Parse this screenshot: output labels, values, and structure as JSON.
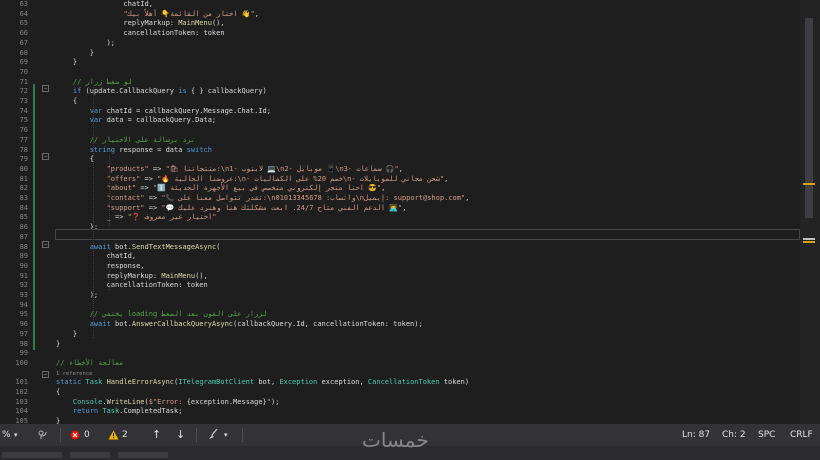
{
  "editor": {
    "lines": [
      {
        "n": "63",
        "code": [
          {
            "c": "p",
            "t": "                chatId,"
          }
        ]
      },
      {
        "n": "64",
        "code": [
          {
            "c": "p",
            "t": "                "
          },
          {
            "c": "s",
            "t": "\"اختار من القائمة👇 أهلاً بيك 👋\""
          },
          {
            "c": "p",
            "t": ","
          }
        ]
      },
      {
        "n": "65",
        "code": [
          {
            "c": "p",
            "t": "                replyMarkup: "
          },
          {
            "c": "m",
            "t": "MainMenu"
          },
          {
            "c": "p",
            "t": "(),"
          }
        ]
      },
      {
        "n": "66",
        "code": [
          {
            "c": "p",
            "t": "                cancellationToken: token"
          }
        ]
      },
      {
        "n": "67",
        "code": [
          {
            "c": "p",
            "t": "            );"
          }
        ]
      },
      {
        "n": "68",
        "code": [
          {
            "c": "p",
            "t": "        }"
          }
        ]
      },
      {
        "n": "69",
        "code": [
          {
            "c": "p",
            "t": "    }"
          }
        ]
      },
      {
        "n": "70",
        "code": []
      },
      {
        "n": "71",
        "code": [
          {
            "c": "c",
            "t": "    // لو ضغط زرار"
          }
        ]
      },
      {
        "n": "72",
        "code": [
          {
            "c": "k",
            "t": "    if"
          },
          {
            "c": "p",
            "t": " (update.CallbackQuery "
          },
          {
            "c": "k",
            "t": "is"
          },
          {
            "c": "p",
            "t": " { } callbackQuery)"
          }
        ]
      },
      {
        "n": "73",
        "code": [
          {
            "c": "p",
            "t": "    {"
          }
        ]
      },
      {
        "n": "74",
        "code": [
          {
            "c": "k",
            "t": "        var"
          },
          {
            "c": "p",
            "t": " chatId = callbackQuery.Message.Chat.Id;"
          }
        ]
      },
      {
        "n": "75",
        "code": [
          {
            "c": "k",
            "t": "        var"
          },
          {
            "c": "p",
            "t": " data = callbackQuery.Data;"
          }
        ]
      },
      {
        "n": "76",
        "code": []
      },
      {
        "n": "77",
        "code": [
          {
            "c": "c",
            "t": "        // نرد برسالة على الاختيار"
          }
        ]
      },
      {
        "n": "78",
        "code": [
          {
            "c": "k",
            "t": "        string"
          },
          {
            "c": "p",
            "t": " response = data "
          },
          {
            "c": "k",
            "t": "switch"
          }
        ]
      },
      {
        "n": "79",
        "code": [
          {
            "c": "p",
            "t": "        {"
          }
        ]
      },
      {
        "n": "80",
        "code": [
          {
            "c": "s",
            "t": "            \"products\""
          },
          {
            "c": "p",
            "t": " => "
          },
          {
            "c": "s",
            "t": "\"🛍 منتجاتنا:\\n1- لابتوب 💻\\n2- موبايل 📱\\n3- سماعات 🎧\""
          },
          {
            "c": "p",
            "t": ","
          }
        ]
      },
      {
        "n": "81",
        "code": [
          {
            "c": "s",
            "t": "            \"offers\""
          },
          {
            "c": "p",
            "t": " => "
          },
          {
            "c": "s",
            "t": "\"🔥 عروضنا الحالية:\\n- خصم 20% على الكماليات\\n- شحن مجاني للموبايلات\""
          },
          {
            "c": "p",
            "t": ","
          }
        ]
      },
      {
        "n": "82",
        "code": [
          {
            "c": "s",
            "t": "            \"about\""
          },
          {
            "c": "p",
            "t": " => "
          },
          {
            "c": "s",
            "t": "\"ℹ️ احنا متجر إلكتروني متخصص في بيع الأجهزة الحديثة 😎\""
          },
          {
            "c": "p",
            "t": ","
          }
        ]
      },
      {
        "n": "83",
        "code": [
          {
            "c": "s",
            "t": "            \"contact\""
          },
          {
            "c": "p",
            "t": " => "
          },
          {
            "c": "s",
            "t": "\"📞 تقدر تتواصل معنا على:\\nواتساب: 01013345678\\nإيميل: support@shop.com\""
          },
          {
            "c": "p",
            "t": ","
          }
        ]
      },
      {
        "n": "84",
        "code": [
          {
            "c": "s",
            "t": "            \"support\""
          },
          {
            "c": "p",
            "t": " => "
          },
          {
            "c": "s",
            "t": "\"💬 الدعم الفني متاح 24/7. ابعت مشكلتك هنا وهنرد عليك 👨‍💻\""
          },
          {
            "c": "p",
            "t": ","
          }
        ]
      },
      {
        "n": "85",
        "code": [
          {
            "c": "p",
            "t": "            _ => "
          },
          {
            "c": "s",
            "t": "\"❓ اختيار غير معروف\""
          }
        ]
      },
      {
        "n": "86",
        "code": [
          {
            "c": "p",
            "t": "        };"
          }
        ]
      },
      {
        "n": "87",
        "code": []
      },
      {
        "n": "88",
        "code": [
          {
            "c": "k",
            "t": "        await"
          },
          {
            "c": "p",
            "t": " bot."
          },
          {
            "c": "m",
            "t": "SendTextMessageAsync"
          },
          {
            "c": "p",
            "t": "("
          }
        ]
      },
      {
        "n": "89",
        "code": [
          {
            "c": "p",
            "t": "            chatId,"
          }
        ]
      },
      {
        "n": "90",
        "code": [
          {
            "c": "p",
            "t": "            response,"
          }
        ]
      },
      {
        "n": "91",
        "code": [
          {
            "c": "p",
            "t": "            replyMarkup: "
          },
          {
            "c": "m",
            "t": "MainMenu"
          },
          {
            "c": "p",
            "t": "(),"
          }
        ]
      },
      {
        "n": "92",
        "code": [
          {
            "c": "p",
            "t": "            cancellationToken: token"
          }
        ]
      },
      {
        "n": "93",
        "code": [
          {
            "c": "p",
            "t": "        );"
          }
        ]
      },
      {
        "n": "94",
        "code": []
      },
      {
        "n": "95",
        "code": [
          {
            "c": "c",
            "t": "        // يختفي loading لزرار على الفون بعد الضغط"
          }
        ]
      },
      {
        "n": "96",
        "code": [
          {
            "c": "k",
            "t": "        await"
          },
          {
            "c": "p",
            "t": " bot."
          },
          {
            "c": "m",
            "t": "AnswerCallbackQueryAsync"
          },
          {
            "c": "p",
            "t": "(callbackQuery.Id, cancellationToken: token);"
          }
        ]
      },
      {
        "n": "97",
        "code": [
          {
            "c": "p",
            "t": "    }"
          }
        ]
      },
      {
        "n": "98",
        "code": [
          {
            "c": "p",
            "t": "}"
          }
        ]
      },
      {
        "n": "99",
        "code": []
      },
      {
        "n": "100",
        "code": [
          {
            "c": "c",
            "t": "// معالجة الأخطاء"
          }
        ]
      },
      {
        "n": "",
        "code": [
          {
            "c": "ref",
            "t": "1 reference"
          }
        ]
      },
      {
        "n": "101",
        "code": [
          {
            "c": "k",
            "t": "static"
          },
          {
            "c": "p",
            "t": " "
          },
          {
            "c": "t",
            "t": "Task"
          },
          {
            "c": "p",
            "t": " "
          },
          {
            "c": "m",
            "t": "HandleErrorAsync"
          },
          {
            "c": "p",
            "t": "("
          },
          {
            "c": "t",
            "t": "ITelegramBotClient"
          },
          {
            "c": "p",
            "t": " bot, "
          },
          {
            "c": "t",
            "t": "Exception"
          },
          {
            "c": "p",
            "t": " exception, "
          },
          {
            "c": "t",
            "t": "CancellationToken"
          },
          {
            "c": "p",
            "t": " token)"
          }
        ]
      },
      {
        "n": "102",
        "code": [
          {
            "c": "p",
            "t": "{"
          }
        ]
      },
      {
        "n": "103",
        "code": [
          {
            "c": "p",
            "t": "    "
          },
          {
            "c": "t",
            "t": "Console"
          },
          {
            "c": "p",
            "t": "."
          },
          {
            "c": "m",
            "t": "WriteLine"
          },
          {
            "c": "p",
            "t": "("
          },
          {
            "c": "s",
            "t": "$\"Error: "
          },
          {
            "c": "p",
            "t": "{exception.Message}"
          },
          {
            "c": "s",
            "t": "\""
          },
          {
            "c": "p",
            "t": ");"
          }
        ]
      },
      {
        "n": "104",
        "code": [
          {
            "c": "k",
            "t": "    return"
          },
          {
            "c": "p",
            "t": " "
          },
          {
            "c": "t",
            "t": "Task"
          },
          {
            "c": "p",
            "t": ".CompletedTask;"
          }
        ]
      },
      {
        "n": "105",
        "code": [
          {
            "c": "p",
            "t": "}"
          }
        ]
      }
    ]
  },
  "status": {
    "zoom": "%",
    "errors": "0",
    "warnings": "2",
    "line_col": "Ln: 87",
    "char_col": "Ch: 2",
    "whitespace": "SPC",
    "line_ending": "CRLF"
  },
  "icons": {
    "errors": "error-circle-icon",
    "warnings": "warning-triangle-icon",
    "up": "arrow-up-icon",
    "down": "arrow-down-icon",
    "brush": "code-cleanup-icon",
    "git": "git-icon"
  },
  "colors": {
    "error": "#e51400",
    "warning": "#f0b400"
  },
  "watermark": "خمسات"
}
